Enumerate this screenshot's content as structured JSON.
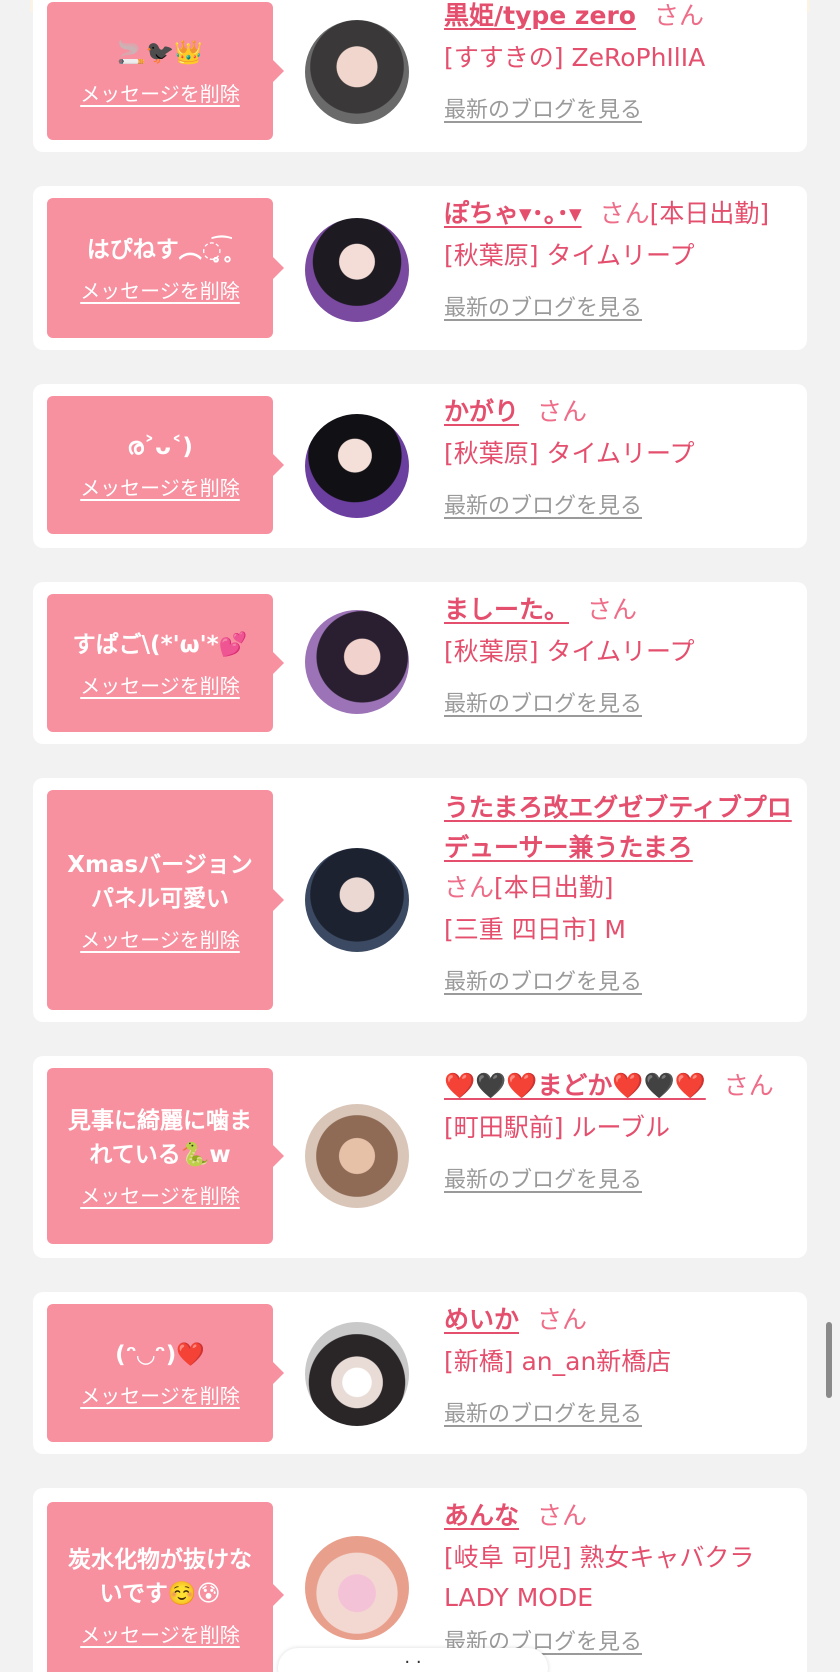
{
  "link_label": "メッセージを削除",
  "blog_label": "最新のブログを見る",
  "honorific": "さん",
  "accent_color": "#e44f6e",
  "bubble_color": "#f7909f",
  "cards": [
    {
      "message": "🚬🐦‍⬛👑",
      "name": "黒姫/type zero",
      "shift": "",
      "shop": "[すすきの] ZeRoPhIlIA"
    },
    {
      "message": "はぴねす︵◌̥̥̥̥̥̥̥̥̥̥̥̥̥̥̥̥̥̥̥̥̥̥̥̥̥͡˳",
      "name": "ぽちゃ▾･｡･▾",
      "shift": "[本日出勤]",
      "shop": "[秋葉原] タイムリープ"
    },
    {
      "message": "ര˃ᴗ˂)",
      "name": "かがり",
      "shift": "",
      "shop": "[秋葉原] タイムリープ"
    },
    {
      "message": "すぱご\\(*'ω'*💕",
      "name": "ましーた。",
      "shift": "",
      "shop": "[秋葉原] タイムリープ"
    },
    {
      "message": "Xmasバージョン\nパネル可愛い",
      "name": "うたまろ改エグゼブティブプロデューサー兼うたまろ",
      "shift": "[本日出勤]",
      "shop": "[三重 四日市] M"
    },
    {
      "message": "見事に綺麗に噛ま\nれている🐍w",
      "name": "❤️🖤❤️まどか❤️🖤❤️",
      "shift": "",
      "shop": "[町田駅前] ルーブル"
    },
    {
      "message": "(ᵔ◡ᵔ)❤️",
      "name": "めいか",
      "shift": "",
      "shop": "[新橋] an_an新橋店"
    },
    {
      "message": "炭水化物が抜けな\nいです☺️😰",
      "name": "あんな",
      "shift": "",
      "shop": "[岐阜 可児] 熟女キャバクラ LADY MODE"
    }
  ],
  "bottom_bar_text": "· ·"
}
